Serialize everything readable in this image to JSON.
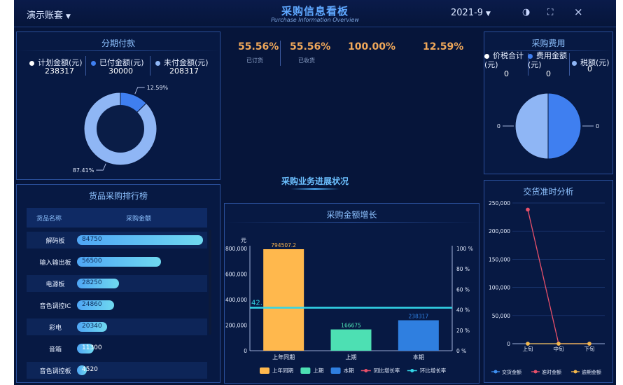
{
  "header": {
    "account": "演示账套",
    "title": "采购信息看板",
    "subtitle": "Purchase Information Overview",
    "period": "2021-9",
    "theme_icon": "◑",
    "fullscreen_icon": "⛶",
    "close_icon": "×"
  },
  "installment": {
    "title": "分期付款",
    "legend": [
      {
        "label": "计划金额(元)",
        "value": "238317",
        "color": "#ffffff"
      },
      {
        "label": "已付金额(元)",
        "value": "30000",
        "color": "#3f7ff0"
      },
      {
        "label": "未付金额(元)",
        "value": "208317",
        "color": "#8fb6f5"
      }
    ],
    "chart_data": {
      "type": "pie",
      "donut": true,
      "slices": [
        {
          "name": "已付金额",
          "value": 12.59,
          "label": "12.59%",
          "color": "#3f7ff0"
        },
        {
          "name": "未付金额",
          "value": 87.41,
          "label": "87.41%",
          "color": "#8fb6f5"
        }
      ]
    }
  },
  "kpis": [
    {
      "value": "55.56%",
      "label": "已订货"
    },
    {
      "value": "55.56%",
      "label": "已收货"
    },
    {
      "value": "100.00%",
      "label": ""
    },
    {
      "value": "12.59%",
      "label": ""
    }
  ],
  "ranking": {
    "title": "货品采购排行榜",
    "col_name": "货品名称",
    "col_amount": "采购金额",
    "max": 100000,
    "rows": [
      {
        "name": "解码板",
        "value": 84750,
        "label": "84750"
      },
      {
        "name": "输入输出板",
        "value": 56500,
        "label": "56500"
      },
      {
        "name": "电源板",
        "value": 28250,
        "label": "28250"
      },
      {
        "name": "音色调控IC",
        "value": 24860,
        "label": "24860"
      },
      {
        "name": "彩电",
        "value": 20340,
        "label": "20340"
      },
      {
        "name": "音箱",
        "value": 11300,
        "label": "11300"
      },
      {
        "name": "音色调控板",
        "value": 4520,
        "label": "4520"
      }
    ]
  },
  "progress": {
    "title": "采购业务进展状况"
  },
  "growth": {
    "title": "采购金额增长",
    "chart_data": {
      "type": "bar",
      "y_unit": "元",
      "categories": [
        "上年同期",
        "上期",
        "本期"
      ],
      "values": [
        794507.2,
        166675,
        238317
      ],
      "value_labels": [
        "794507.2",
        "166675",
        "238317"
      ],
      "colors": [
        "#ffb84d",
        "#4de0b3",
        "#2f7fe0"
      ],
      "ylim": [
        0,
        800000
      ],
      "yticks": [
        "0",
        "200,000",
        "400,000",
        "600,000",
        "800,000"
      ],
      "y2lim": [
        0,
        100
      ],
      "y2ticks": [
        "0 %",
        "20 %",
        "40 %",
        "60 %",
        "80 %",
        "100 %"
      ],
      "line_value": 42,
      "line_label": "42.",
      "legend": [
        {
          "name": "上年同期",
          "color": "#ffb84d",
          "kind": "box"
        },
        {
          "name": "上期",
          "color": "#4de0b3",
          "kind": "box"
        },
        {
          "name": "本期",
          "color": "#2f7fe0",
          "kind": "box"
        },
        {
          "name": "同比增长率",
          "color": "#e8506a",
          "kind": "line"
        },
        {
          "name": "环比增长率",
          "color": "#33d6e8",
          "kind": "line"
        }
      ]
    }
  },
  "fees": {
    "title": "采购费用",
    "legend": [
      {
        "label": "价税合计",
        "unit": "(元)",
        "value": "0",
        "color": "#ffffff"
      },
      {
        "label": "费用金额",
        "unit": "(元)",
        "value": "0",
        "color": "#3f7ff0"
      },
      {
        "label": "税额(元)",
        "unit": "",
        "value": "0",
        "color": "#8fb6f5"
      }
    ],
    "chart_data": {
      "type": "pie",
      "slices": [
        {
          "name": "费用金额",
          "value": 0,
          "label": "0",
          "color": "#3f7ff0"
        },
        {
          "name": "税额",
          "value": 0,
          "label": "0",
          "color": "#8fb6f5"
        }
      ]
    }
  },
  "delivery": {
    "title": "交货准时分析",
    "chart_data": {
      "type": "line",
      "categories": [
        "上旬",
        "中旬",
        "下旬"
      ],
      "ylim": [
        0,
        250000
      ],
      "yticks": [
        "0",
        "50,000",
        "100,000",
        "150,000",
        "200,000",
        "250,000"
      ],
      "series": [
        {
          "name": "交货金额",
          "color": "#3f8ff0",
          "values": [
            0,
            0,
            0
          ]
        },
        {
          "name": "准时金额",
          "color": "#e8506a",
          "values": [
            238317,
            0,
            0
          ]
        },
        {
          "name": "逾期金额",
          "color": "#f5b84a",
          "values": [
            0,
            0,
            0
          ]
        }
      ]
    }
  }
}
